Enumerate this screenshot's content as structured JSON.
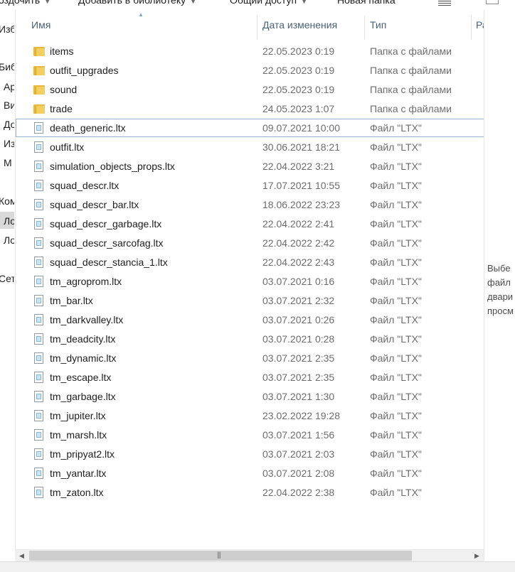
{
  "toolbar": {
    "items": [
      {
        "label": "оздочить"
      },
      {
        "label": "Добавить в библиотеку"
      },
      {
        "label": "Общий доступ"
      },
      {
        "label": "Новая папка"
      }
    ]
  },
  "nav": {
    "items": [
      {
        "label": "Изб"
      },
      {
        "label": "Биб"
      },
      {
        "label": "Ар"
      },
      {
        "label": "Ви"
      },
      {
        "label": "До"
      },
      {
        "label": "Из"
      },
      {
        "label": "М"
      },
      {
        "label": "Ком"
      },
      {
        "label": "Ло"
      },
      {
        "label": "Ло"
      },
      {
        "label": "Сет"
      }
    ]
  },
  "columns": {
    "name": "Имя",
    "date": "Дата изменения",
    "type": "Тип",
    "size": "Ра"
  },
  "rows": [
    {
      "name": "items",
      "date": "22.05.2023 0:19",
      "type": "Папка с файлами",
      "kind": "folder"
    },
    {
      "name": "outfit_upgrades",
      "date": "22.05.2023 0:19",
      "type": "Папка с файлами",
      "kind": "folder"
    },
    {
      "name": "sound",
      "date": "22.05.2023 0:19",
      "type": "Папка с файлами",
      "kind": "folder"
    },
    {
      "name": "trade",
      "date": "24.05.2023 1:07",
      "type": "Папка с файлами",
      "kind": "folder"
    },
    {
      "name": "death_generic.ltx",
      "date": "09.07.2021 10:00",
      "type": "Файл \"LTX\"",
      "kind": "file",
      "selected": true
    },
    {
      "name": "outfit.ltx",
      "date": "30.06.2021 18:21",
      "type": "Файл \"LTX\"",
      "kind": "file"
    },
    {
      "name": "simulation_objects_props.ltx",
      "date": "22.04.2022 3:21",
      "type": "Файл \"LTX\"",
      "kind": "file"
    },
    {
      "name": "squad_descr.ltx",
      "date": "17.07.2021 10:55",
      "type": "Файл \"LTX\"",
      "kind": "file"
    },
    {
      "name": "squad_descr_bar.ltx",
      "date": "18.06.2022 23:23",
      "type": "Файл \"LTX\"",
      "kind": "file"
    },
    {
      "name": "squad_descr_garbage.ltx",
      "date": "22.04.2022 2:41",
      "type": "Файл \"LTX\"",
      "kind": "file"
    },
    {
      "name": "squad_descr_sarcofag.ltx",
      "date": "22.04.2022 2:42",
      "type": "Файл \"LTX\"",
      "kind": "file"
    },
    {
      "name": "squad_descr_stancia_1.ltx",
      "date": "22.04.2022 2:43",
      "type": "Файл \"LTX\"",
      "kind": "file"
    },
    {
      "name": "tm_agroprom.ltx",
      "date": "03.07.2021 0:16",
      "type": "Файл \"LTX\"",
      "kind": "file"
    },
    {
      "name": "tm_bar.ltx",
      "date": "03.07.2021 2:32",
      "type": "Файл \"LTX\"",
      "kind": "file"
    },
    {
      "name": "tm_darkvalley.ltx",
      "date": "03.07.2021 0:26",
      "type": "Файл \"LTX\"",
      "kind": "file"
    },
    {
      "name": "tm_deadcity.ltx",
      "date": "03.07.2021 0:28",
      "type": "Файл \"LTX\"",
      "kind": "file"
    },
    {
      "name": "tm_dynamic.ltx",
      "date": "03.07.2021 2:35",
      "type": "Файл \"LTX\"",
      "kind": "file"
    },
    {
      "name": "tm_escape.ltx",
      "date": "03.07.2021 2:35",
      "type": "Файл \"LTX\"",
      "kind": "file"
    },
    {
      "name": "tm_garbage.ltx",
      "date": "03.07.2021 1:30",
      "type": "Файл \"LTX\"",
      "kind": "file"
    },
    {
      "name": "tm_jupiter.ltx",
      "date": "23.02.2022 19:28",
      "type": "Файл \"LTX\"",
      "kind": "file"
    },
    {
      "name": "tm_marsh.ltx",
      "date": "03.07.2021 1:56",
      "type": "Файл \"LTX\"",
      "kind": "file"
    },
    {
      "name": "tm_pripyat2.ltx",
      "date": "03.07.2021 2:03",
      "type": "Файл \"LTX\"",
      "kind": "file"
    },
    {
      "name": "tm_yantar.ltx",
      "date": "03.07.2021 2:08",
      "type": "Файл \"LTX\"",
      "kind": "file"
    },
    {
      "name": "tm_zaton.ltx",
      "date": "22.04.2022 2:38",
      "type": "Файл \"LTX\"",
      "kind": "file"
    }
  ],
  "preview": {
    "lines": [
      "Выбе",
      "файл",
      "двари",
      "просм"
    ]
  },
  "scrollbar": {
    "grip": "|||"
  },
  "colors": {
    "folder": "#e8b73d",
    "selection_border": "#99b4d1",
    "header_text": "#4c607a"
  }
}
